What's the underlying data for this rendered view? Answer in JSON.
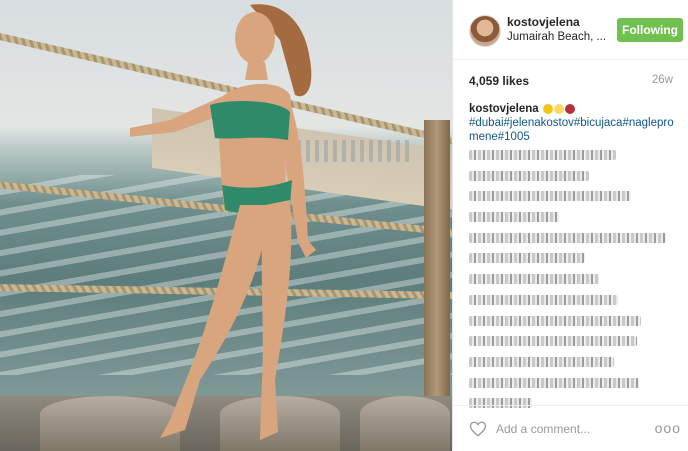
{
  "post": {
    "username": "kostovjelena",
    "location": "Jumairah Beach, ...",
    "follow_label": "Following",
    "likes": "4,059 likes",
    "age": "26w",
    "caption_user": "kostovjelena",
    "hashtags": "#dubai#jelenakostov#bicujaca#naglepromene#1005",
    "comment_placeholder": "Add a comment...",
    "more_label": "ooo"
  },
  "comments": [
    {
      "width": 0.7
    },
    {
      "width": 0.57
    },
    {
      "width": 0.77
    },
    {
      "width": 0.43
    },
    {
      "width": 0.94
    },
    {
      "width": 0.55
    },
    {
      "width": 0.62
    },
    {
      "width": 0.71
    },
    {
      "width": 0.82
    },
    {
      "width": 0.8
    },
    {
      "width": 0.69
    },
    {
      "width": 0.81
    },
    {
      "width": 0.3
    }
  ],
  "colors": {
    "follow": "#70c050",
    "hashtag": "#125688"
  }
}
